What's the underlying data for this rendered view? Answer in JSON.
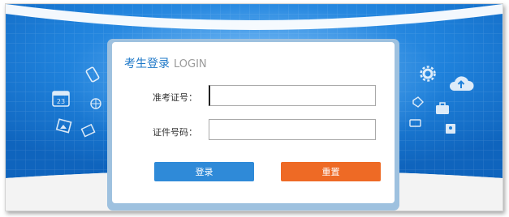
{
  "login_panel": {
    "title": "考生登录",
    "subtitle": "LOGIN"
  },
  "form": {
    "candidate_number_label": "准考证号：",
    "candidate_number_value": "",
    "id_number_label": "证件号码：",
    "id_number_value": ""
  },
  "buttons": {
    "login_label": "登录",
    "reset_label": "重置"
  },
  "decor": {
    "calendar_day": "23",
    "icons": [
      "phone-icon",
      "calendar-icon",
      "globe-icon",
      "photo-icon",
      "mail-icon",
      "gear-icon",
      "cloud-upload-icon",
      "tag-icon",
      "briefcase-icon",
      "file-icon"
    ]
  },
  "colors": {
    "banner_blue": "#1a7ad2",
    "title_blue": "#1e78c8",
    "login_button": "#2f8ad8",
    "reset_button": "#ee6a25"
  }
}
